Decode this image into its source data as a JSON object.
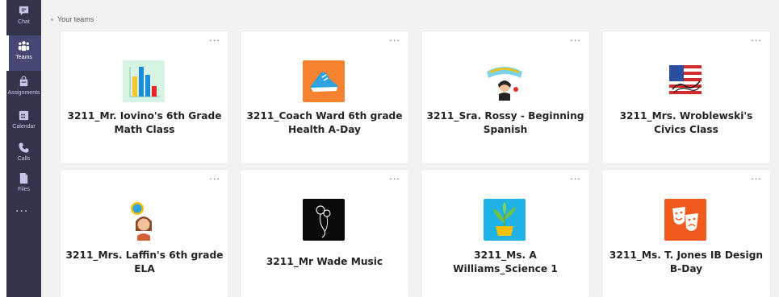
{
  "sidebar": {
    "items": [
      {
        "label": "Chat",
        "icon": "chat-icon"
      },
      {
        "label": "Teams",
        "icon": "teams-icon",
        "active": true
      },
      {
        "label": "Assignments",
        "icon": "assignments-icon"
      },
      {
        "label": "Calendar",
        "icon": "calendar-icon"
      },
      {
        "label": "Calls",
        "icon": "calls-icon"
      },
      {
        "label": "Files",
        "icon": "files-icon"
      }
    ],
    "more": "..."
  },
  "main": {
    "breadcrumb": "Your teams",
    "more_options": "...",
    "teams": [
      {
        "name": "3211_Mr. Iovino's 6th Grade Math Class",
        "avatar_icon": "bar-chart-avatar",
        "avatar_bg": "#d7f3e3"
      },
      {
        "name": "3211_Coach Ward 6th grade Health A-Day",
        "avatar_icon": "sneaker-avatar",
        "avatar_bg": "#f4822f"
      },
      {
        "name": "3211_Sra. Rossy - Beginning Spanish",
        "avatar_icon": "beginning-spanish-bitmoji-avatar",
        "avatar_bg": "#ffffff"
      },
      {
        "name": "3211_Mrs. Wroblewski's Civics Class",
        "avatar_icon": "civics-flag-avatar",
        "avatar_bg": "#ffffff"
      },
      {
        "name": "3211_Mrs. Laffin's 6th grade ELA",
        "avatar_icon": "bitmoji-avatar",
        "avatar_bg": "#ffffff"
      },
      {
        "name": "3211_Mr Wade Music",
        "avatar_icon": "music-sketch-avatar",
        "avatar_bg": "#0a0a0a"
      },
      {
        "name": "3211_Ms. A Williams_Science 1",
        "avatar_icon": "potted-plant-avatar",
        "avatar_bg": "#1eb2e6"
      },
      {
        "name": "3211_Ms. T. Jones IB Design B-Day",
        "avatar_icon": "theater-masks-avatar",
        "avatar_bg": "#f05a1f"
      }
    ]
  },
  "colors": {
    "rail": "#33344a",
    "rail_active": "#464775",
    "canvas": "#f3f2f1",
    "card": "#ffffff",
    "text": "#252423"
  }
}
